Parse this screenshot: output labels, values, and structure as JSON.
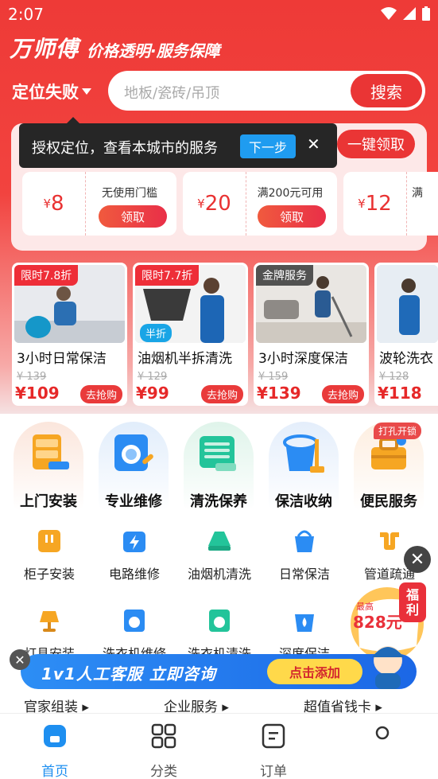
{
  "status_bar": {
    "time": "2:07"
  },
  "brand": {
    "name": "万师傅",
    "slogan": "价格透明·服务保障"
  },
  "location": {
    "label": "定位失败"
  },
  "search": {
    "placeholder": "地板/瓷砖/吊顶",
    "button_label": "搜索"
  },
  "tooltip": {
    "text": "授权定位，查看本城市的服务",
    "next_label": "下一步",
    "close_symbol": "✕"
  },
  "coupons": {
    "claim_all_label": "一键领取",
    "items": [
      {
        "currency": "¥",
        "amount": "8",
        "condition": "无使用门槛",
        "button": "领取"
      },
      {
        "currency": "¥",
        "amount": "20",
        "condition": "满200元可用",
        "button": "领取"
      },
      {
        "currency": "¥",
        "amount": "12",
        "condition": "满",
        "button": ""
      }
    ]
  },
  "deals": [
    {
      "tag": "限时7.8折",
      "title": "3小时日常保洁",
      "old_price": "¥ 139",
      "price": "¥109",
      "button": "去抢购"
    },
    {
      "tag": "限时7.7折",
      "badge": "半折",
      "title": "油烟机半拆清洗",
      "old_price": "¥ 129",
      "price": "¥99",
      "button": "去抢购"
    },
    {
      "tag": "金牌服务",
      "title": "3小时深度保洁",
      "old_price": "¥ 159",
      "price": "¥139",
      "button": "去抢购"
    },
    {
      "tag": "",
      "title": "波轮洗衣",
      "old_price": "¥ 128",
      "price": "¥118",
      "button": ""
    }
  ],
  "categories": [
    {
      "label": "上门安装",
      "icon": "cabinet-drill-icon",
      "color": "#fbe6dc"
    },
    {
      "label": "专业维修",
      "icon": "washer-wrench-icon",
      "color": "#e1edfb"
    },
    {
      "label": "清洗保养",
      "icon": "ac-clean-icon",
      "color": "#dff4ea"
    },
    {
      "label": "保洁收纳",
      "icon": "bucket-mop-icon",
      "color": "#e4eefb"
    },
    {
      "label": "便民服务",
      "icon": "toolbox-icon",
      "color": "#fdeee0"
    }
  ],
  "category_badge": "打孔开锁",
  "sub_services": [
    {
      "label": "柜子安装",
      "icon": "cabinet-icon",
      "color": "#f6a623"
    },
    {
      "label": "电路维修",
      "icon": "battery-icon",
      "color": "#2b8cf3"
    },
    {
      "label": "油烟机清洗",
      "icon": "range-hood-icon",
      "color": "#23c49a"
    },
    {
      "label": "日常保洁",
      "icon": "bucket-icon",
      "color": "#2b8cf3"
    },
    {
      "label": "管道疏通",
      "icon": "pipe-icon",
      "color": "#f6a623"
    }
  ],
  "sub_services_row2_labels": [
    "灯具安装",
    "洗衣机维修",
    "洗衣机清洗",
    "深度保洁",
    ""
  ],
  "promo": {
    "price_line": "828元",
    "top_line": "最高",
    "tag": "福利"
  },
  "banner": {
    "text": "1v1人工客服 立即咨询",
    "button": "点击添加"
  },
  "quick_links": [
    "官家组装",
    "企业服务",
    "超值省钱卡"
  ],
  "tabs": [
    {
      "label": "首页",
      "icon": "home-icon",
      "active": true
    },
    {
      "label": "分类",
      "icon": "grid-icon",
      "active": false
    },
    {
      "label": "订单",
      "icon": "order-icon",
      "active": false
    },
    {
      "label": "",
      "icon": "profile-icon",
      "active": false
    }
  ]
}
